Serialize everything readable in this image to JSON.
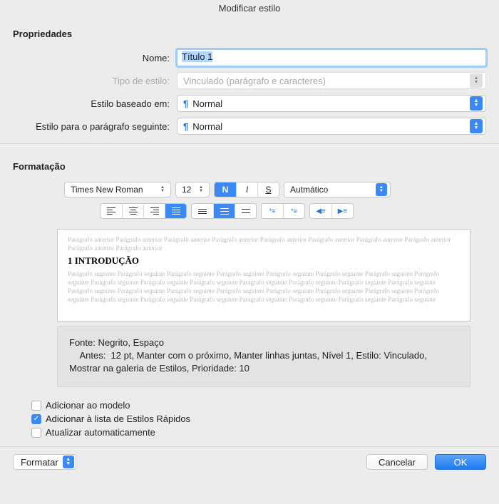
{
  "title": "Modificar estilo",
  "sections": {
    "props": "Propriedades",
    "format": "Formatação"
  },
  "labels": {
    "name": "Nome:",
    "styleType": "Tipo de estilo:",
    "basedOn": "Estilo baseado em:",
    "nextPara": "Estilo para o parágrafo seguinte:"
  },
  "values": {
    "name": "Título 1",
    "styleType": "Vinculado (parágrafo e caracteres)",
    "basedOn": "Normal",
    "nextPara": "Normal"
  },
  "fmt": {
    "font": "Times New Roman",
    "size": "12",
    "bold": "N",
    "italic": "I",
    "underline": "S",
    "color": "Autmático"
  },
  "preview": {
    "prev": "Parágrafo anterior Parágrafo anterior Parágrafo anterior Parágrafo anterior Parágrafo anterior Parágrafo anterior Parágrafo anterior Parágrafo anterior Parágrafo anterior Parágrafo anterior",
    "heading": "1 INTRODUÇÃO",
    "next": "Parágrafo seguinte Parágrafo seguinte Parágrafo seguinte Parágrafo seguinte Parágrafo seguinte Parágrafo seguinte Parágrafo seguinte Parágrafo seguinte Parágrafo seguinte Parágrafo seguinte Parágrafo seguinte Parágrafo seguinte Parágrafo seguinte Parágrafo seguinte Parágrafo seguinte Parágrafo seguinte Parágrafo seguinte Parágrafo seguinte Parágrafo seguinte Parágrafo seguinte Parágrafo seguinte Parágrafo seguinte Parágrafo seguinte Parágrafo seguinte Parágrafo seguinte Parágrafo seguinte Parágrafo seguinte Parágrafo seguinte Parágrafo seguinte Parágrafo seguinte"
  },
  "description": {
    "line1": "Fonte: Negrito, Espaço",
    "line2": "    Antes:  12 pt, Manter com o próximo, Manter linhas juntas, Nível 1, Estilo: Vinculado, Mostrar na galeria de Estilos, Prioridade: 10"
  },
  "checks": {
    "addTemplate": "Adicionar ao modelo",
    "addQuick": "Adicionar à lista de Estilos Rápidos",
    "autoUpdate": "Atualizar automaticamente"
  },
  "footer": {
    "format": "Formatar",
    "cancel": "Cancelar",
    "ok": "OK"
  }
}
